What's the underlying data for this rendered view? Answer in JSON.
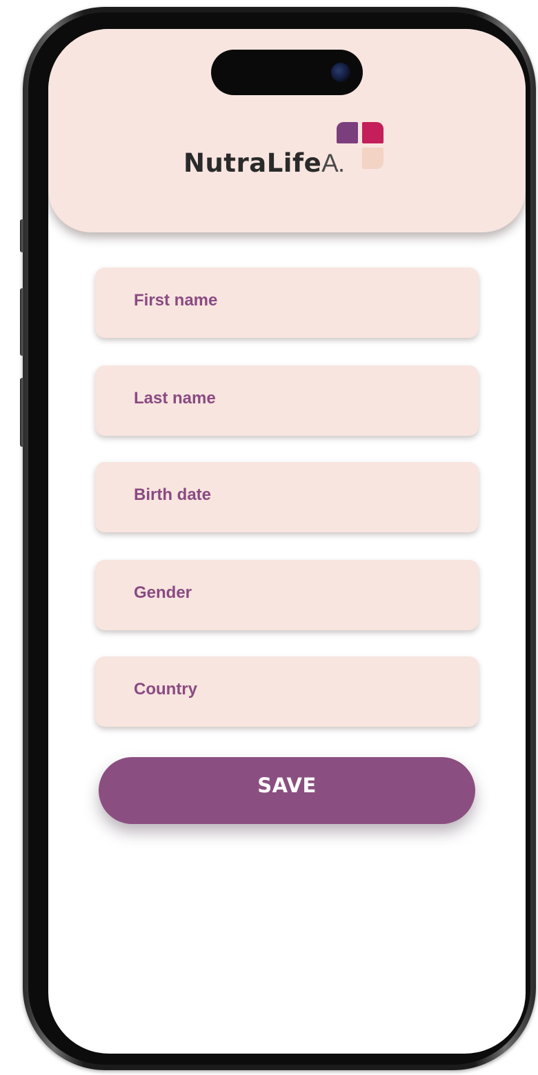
{
  "app": {
    "logo_name": "NutraLife",
    "logo_suffix": "AI",
    "brand_colors": {
      "primary": "#8a4f80",
      "accent": "#c41f5a",
      "surface": "#f8e5df",
      "label": "#8a4a82"
    }
  },
  "form": {
    "fields": [
      {
        "label": "First name"
      },
      {
        "label": "Last name"
      },
      {
        "label": "Birth date"
      },
      {
        "label": "Gender"
      },
      {
        "label": "Country"
      }
    ],
    "save_label": "SAVE"
  }
}
